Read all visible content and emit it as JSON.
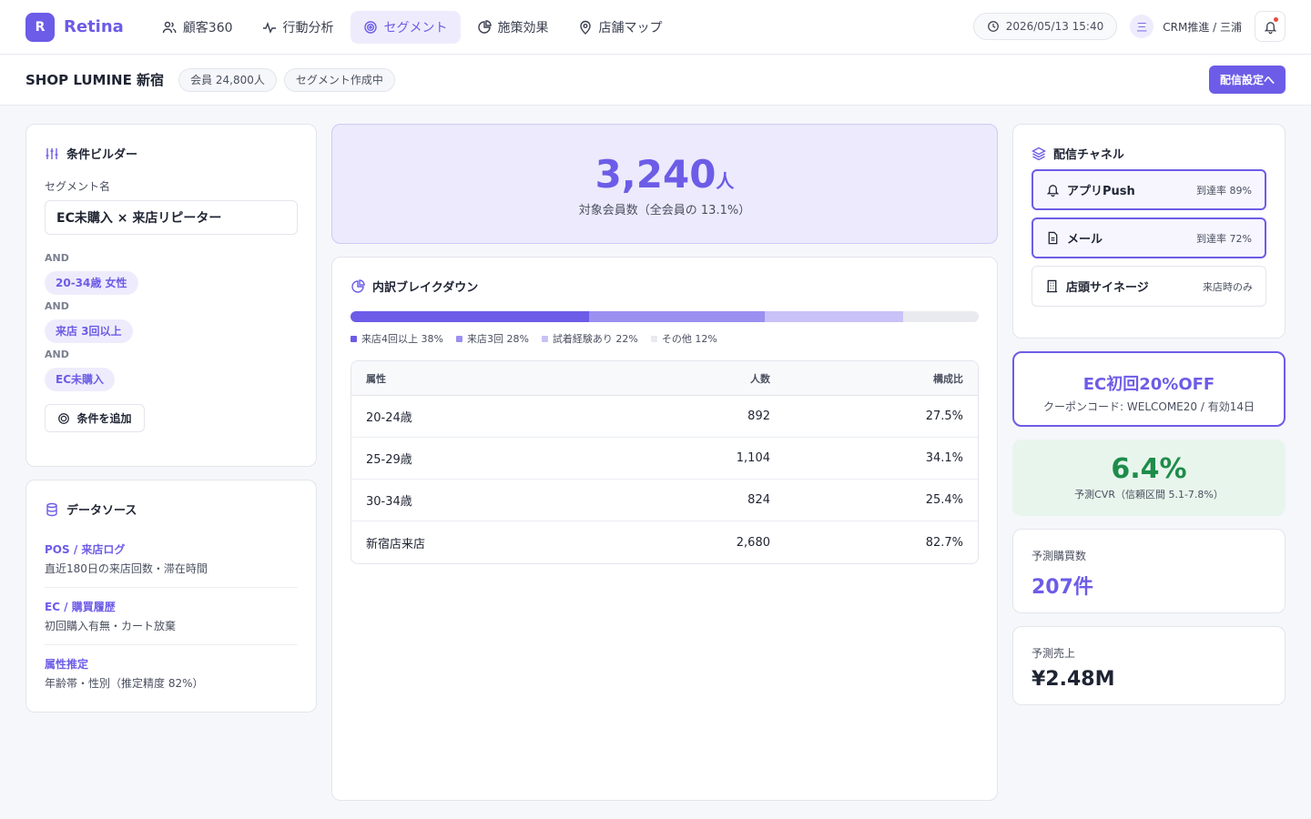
{
  "app": {
    "logo_letter": "R",
    "name": "Retina"
  },
  "nav": [
    {
      "label": "顧客360",
      "icon": "users-icon"
    },
    {
      "label": "行動分析",
      "icon": "activity-icon"
    },
    {
      "label": "セグメント",
      "icon": "target-icon",
      "active": true
    },
    {
      "label": "施策効果",
      "icon": "pie-icon"
    },
    {
      "label": "店舗マップ",
      "icon": "map-pin-icon"
    }
  ],
  "header": {
    "datetime": "2026/05/13 15:40",
    "user_initial": "三",
    "user": "CRM推進 / 三浦"
  },
  "subheader": {
    "shop": "SHOP LUMINE 新宿",
    "members": "会員 24,800人",
    "status": "セグメント作成中",
    "cta": "配信設定へ"
  },
  "builder": {
    "title": "条件ビルダー",
    "name_label": "セグメント名",
    "name_value": "EC未購入 × 来店リピーター",
    "and_label": "AND",
    "conditions": [
      "20-34歳 女性",
      "来店 3回以上",
      "EC未購入"
    ],
    "add_label": "条件を追加"
  },
  "datasource": {
    "title": "データソース",
    "items": [
      {
        "title": "POS / 来店ログ",
        "desc": "直近180日の来店回数・滞在時間"
      },
      {
        "title": "EC / 購買履歴",
        "desc": "初回購入有無・カート放棄"
      },
      {
        "title": "属性推定",
        "desc": "年齢帯・性別（推定精度 82%）"
      }
    ]
  },
  "target": {
    "count": "3,240",
    "unit": "人",
    "sub": "対象会員数（全会員の 13.1%）"
  },
  "breakdown": {
    "title": "内訳ブレイクダウン",
    "segments": [
      {
        "label": "来店4回以上 38%",
        "value": 38,
        "color": "#6c5ce7"
      },
      {
        "label": "来店3回 28%",
        "value": 28,
        "color": "#9b8ff0"
      },
      {
        "label": "試着経験あり 22%",
        "value": 22,
        "color": "#c8c2f7"
      },
      {
        "label": "その他 12%",
        "value": 12,
        "color": "#e9eaef"
      }
    ],
    "columns": [
      "属性",
      "人数",
      "構成比"
    ],
    "rows": [
      [
        "20-24歳",
        "892",
        "27.5%"
      ],
      [
        "25-29歳",
        "1,104",
        "34.1%"
      ],
      [
        "30-34歳",
        "824",
        "25.4%"
      ],
      [
        "新宿店来店",
        "2,680",
        "82.7%"
      ]
    ]
  },
  "channels": {
    "title": "配信チャネル",
    "items": [
      {
        "name": "アプリPush",
        "rate": "到達率 89%",
        "icon": "bell-icon",
        "selected": true
      },
      {
        "name": "メール",
        "rate": "到達率 72%",
        "icon": "document-icon",
        "selected": true
      },
      {
        "name": "店頭サイネージ",
        "rate": "来店時のみ",
        "icon": "building-icon",
        "selected": false
      }
    ]
  },
  "coupon": {
    "title": "EC初回20%OFF",
    "sub": "クーポンコード: WELCOME20 / 有効14日"
  },
  "cvr": {
    "value": "6.4%",
    "sub": "予測CVR（信頼区間 5.1-7.8%）"
  },
  "kpis": [
    {
      "label": "予測購買数",
      "value": "207件",
      "color": "#6c5ce7"
    },
    {
      "label": "予測売上",
      "value": "¥2.48M",
      "color": "#1f2433"
    }
  ]
}
